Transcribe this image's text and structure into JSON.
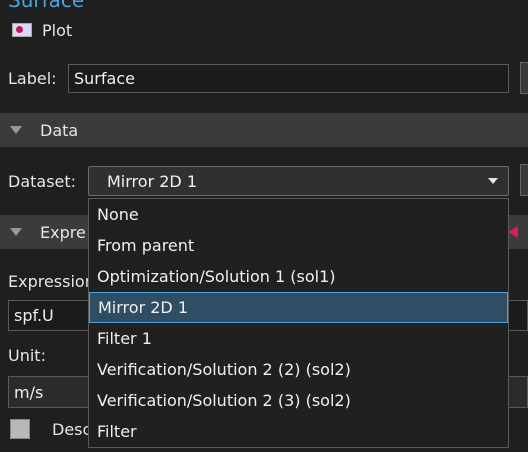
{
  "header": {
    "title": "Surface",
    "plot_label": "Plot",
    "plot_icon": "plot-icon"
  },
  "label_field": {
    "label": "Label:",
    "value": "Surface"
  },
  "data_section": {
    "title": "Data"
  },
  "dataset": {
    "label": "Dataset:",
    "selected": "Mirror 2D 1",
    "options": [
      "None",
      "From parent",
      "Optimization/Solution 1 (sol1)",
      "Mirror 2D 1",
      "Filter 1",
      "Verification/Solution 2 (2) (sol2)",
      "Verification/Solution 2 (3) (sol2)",
      "Filter"
    ],
    "selected_index": 3
  },
  "expression_section": {
    "title": "Expre"
  },
  "expression": {
    "label": "Expression",
    "value": "spf.U"
  },
  "unit": {
    "label": "Unit:",
    "value": "m/s"
  },
  "description": {
    "label": "Desc"
  },
  "colors": {
    "accent": "#4aa3df",
    "highlight": "#2f4e64"
  }
}
